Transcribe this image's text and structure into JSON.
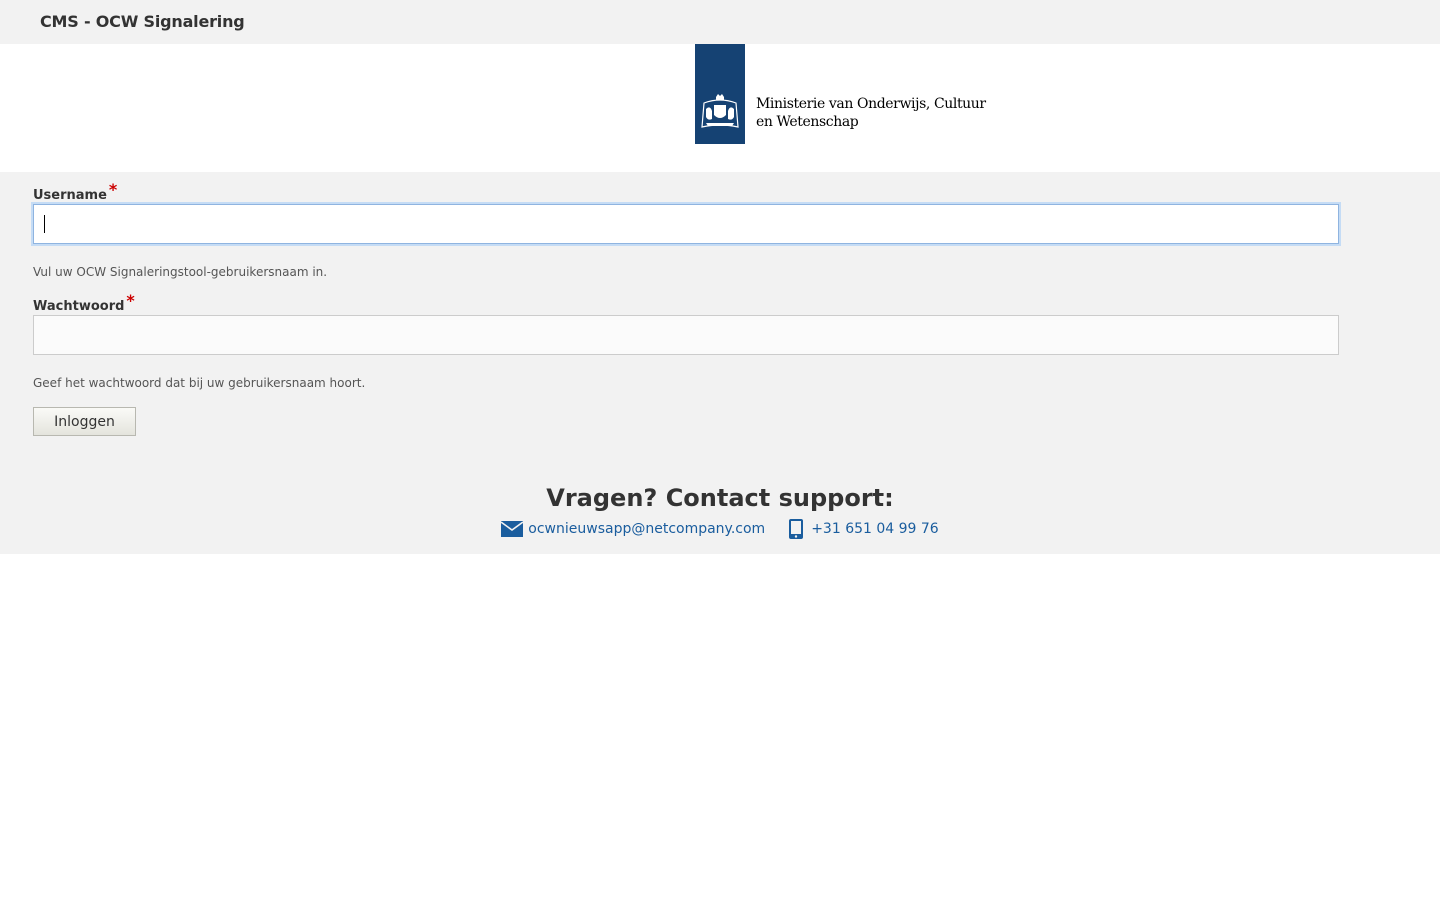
{
  "header": {
    "site_title": "CMS - OCW Signalering"
  },
  "logo": {
    "ministry_name": "Ministerie van Onderwijs, Cultuur en Wetenschap",
    "brand_color": "#154273",
    "icon": "dutch-coat-of-arms-icon"
  },
  "form": {
    "username": {
      "label": "Username",
      "required_mark": "*",
      "value": "",
      "help": "Vul uw OCW Signaleringstool-gebruikersnaam in."
    },
    "password": {
      "label": "Wachtwoord",
      "required_mark": "*",
      "value": "",
      "help": "Geef het wachtwoord dat bij uw gebruikersnaam hoort."
    },
    "submit_label": "Inloggen"
  },
  "support": {
    "heading": "Vragen? Contact support:",
    "email": "ocwnieuwsapp@netcompany.com",
    "phone": "+31 651 04 99 76",
    "link_color": "#1a5d9e"
  }
}
